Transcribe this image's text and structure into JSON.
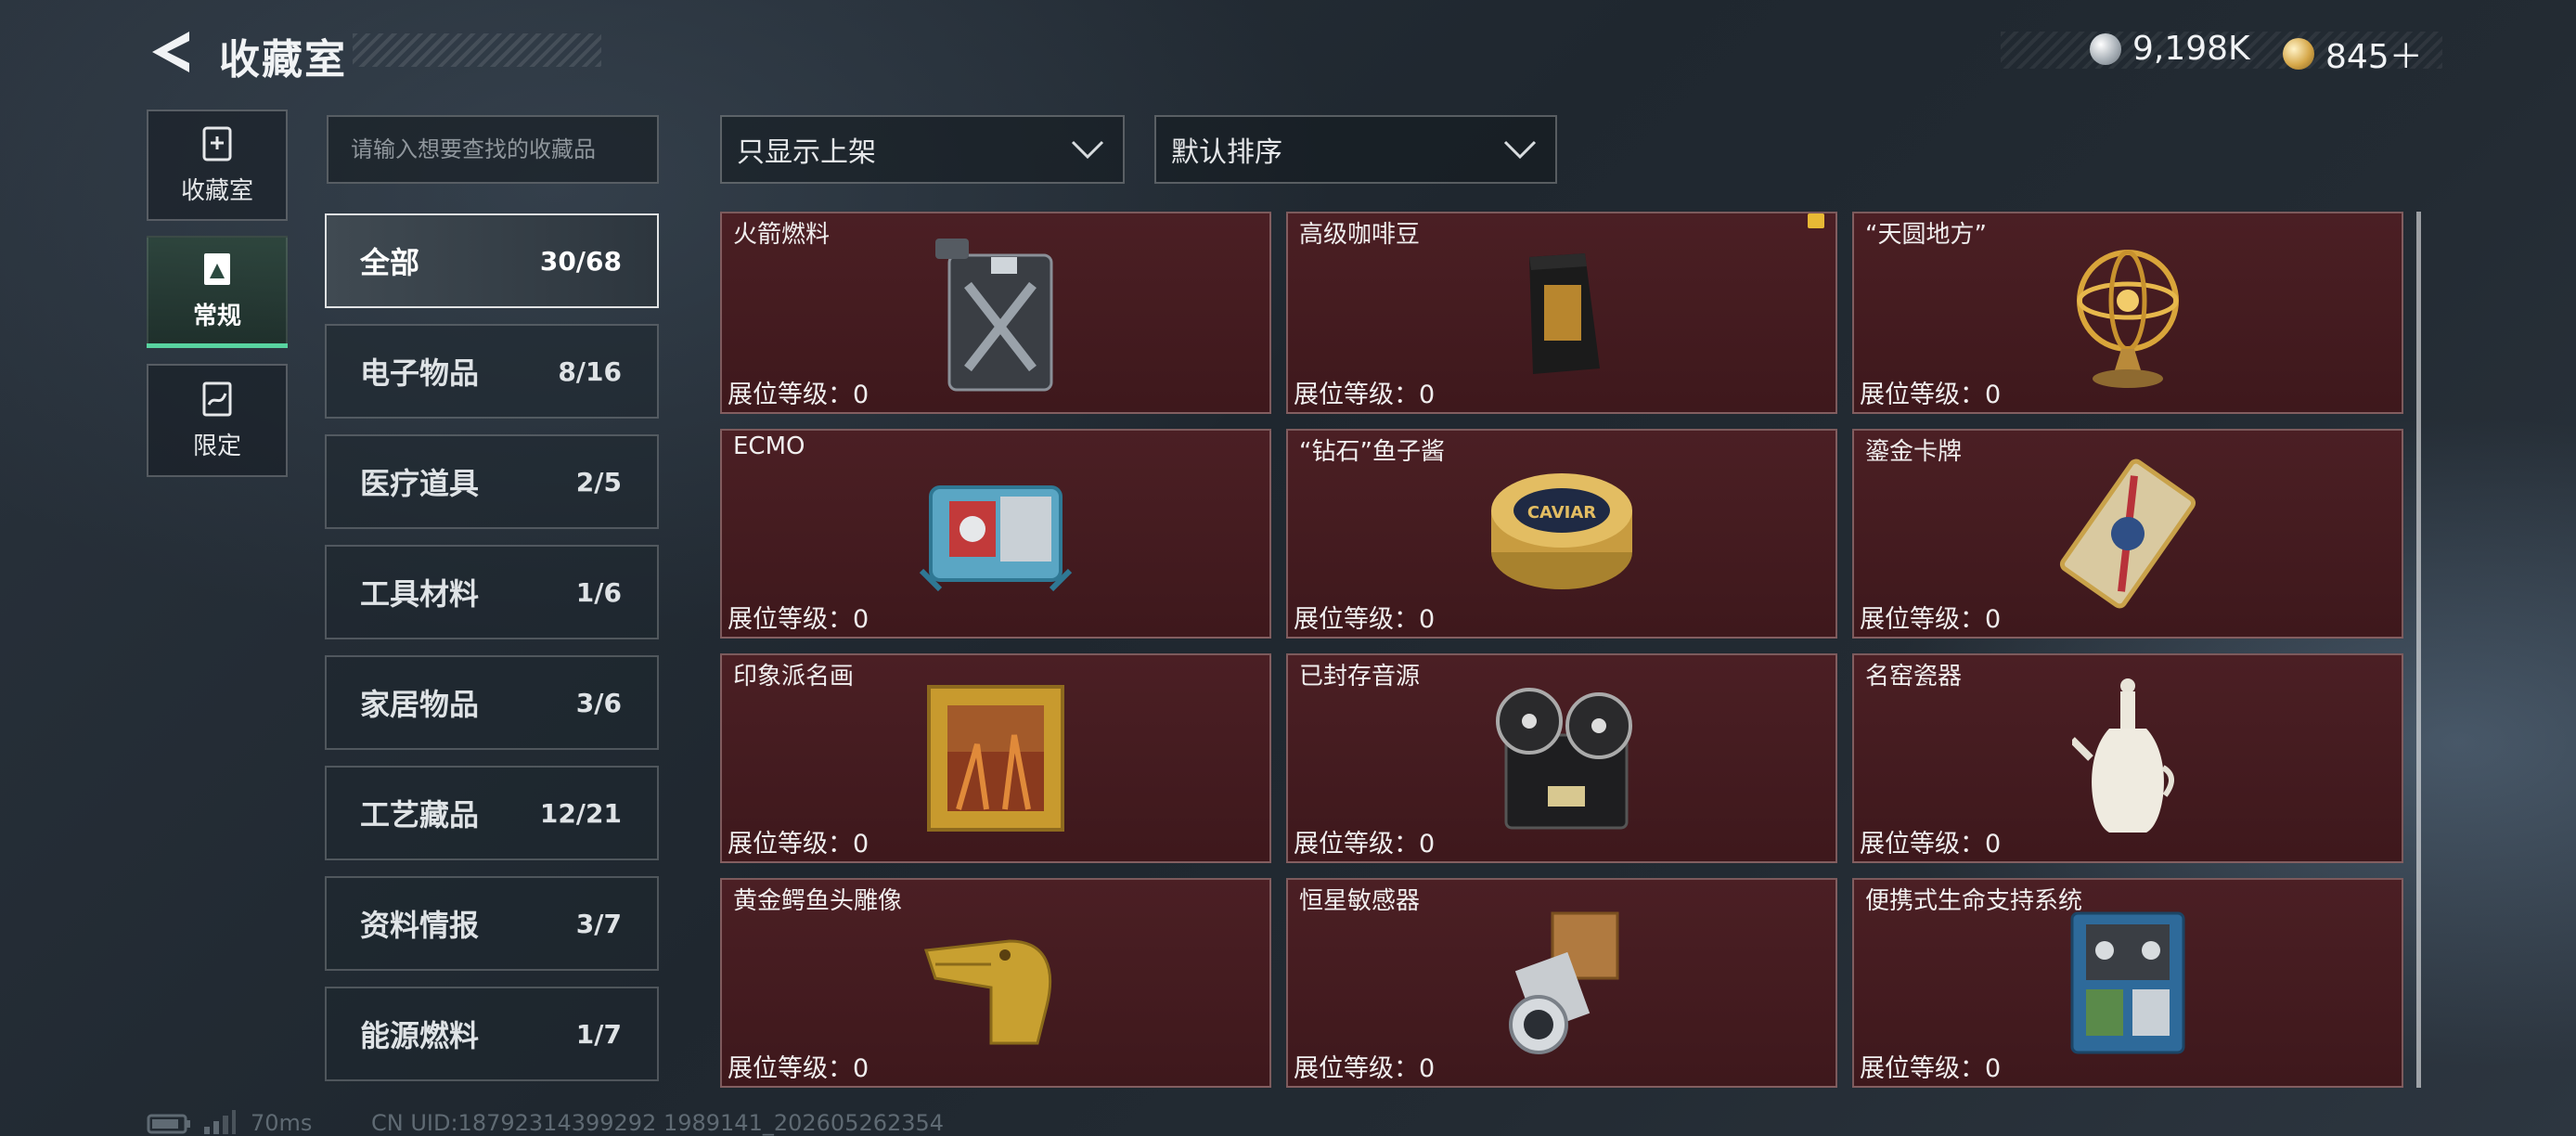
{
  "header": {
    "title": "收藏室",
    "currency_silver": "9,198K",
    "currency_gold": "845＋"
  },
  "nav": [
    {
      "label": "收藏室",
      "icon": "collection-icon",
      "active": false
    },
    {
      "label": "常规",
      "icon": "regular-icon",
      "active": true
    },
    {
      "label": "限定",
      "icon": "limited-icon",
      "active": false
    }
  ],
  "search": {
    "placeholder": "请输入想要查找的收藏品"
  },
  "filters": {
    "display_filter": "只显示上架",
    "sort": "默认排序"
  },
  "categories": [
    {
      "name": "全部",
      "count": "30/68",
      "active": true
    },
    {
      "name": "电子物品",
      "count": "8/16"
    },
    {
      "name": "医疗道具",
      "count": "2/5"
    },
    {
      "name": "工具材料",
      "count": "1/6"
    },
    {
      "name": "家居物品",
      "count": "3/6"
    },
    {
      "name": "工艺藏品",
      "count": "12/21"
    },
    {
      "name": "资料情报",
      "count": "3/7"
    },
    {
      "name": "能源燃料",
      "count": "1/7"
    }
  ],
  "items": [
    {
      "name": "火箭燃料",
      "level": "展位等级：0",
      "icon": "jerrycan-icon"
    },
    {
      "name": "高级咖啡豆",
      "level": "展位等级：0",
      "icon": "coffee-bag-icon",
      "badge": true
    },
    {
      "name": "“天圆地方”",
      "level": "展位等级：0",
      "icon": "armillary-sphere-icon"
    },
    {
      "name": "ECMO",
      "level": "展位等级：0",
      "icon": "ecmo-machine-icon"
    },
    {
      "name": "“钻石”鱼子酱",
      "level": "展位等级：0",
      "icon": "caviar-tin-icon",
      "tin_text": "CAVIAR"
    },
    {
      "name": "鎏金卡牌",
      "level": "展位等级：0",
      "icon": "gilded-card-icon"
    },
    {
      "name": "印象派名画",
      "level": "展位等级：0",
      "icon": "framed-painting-icon"
    },
    {
      "name": "已封存音源",
      "level": "展位等级：0",
      "icon": "reel-tape-recorder-icon"
    },
    {
      "name": "名窑瓷器",
      "level": "展位等级：0",
      "icon": "porcelain-vase-icon"
    },
    {
      "name": "黄金鳄鱼头雕像",
      "level": "展位等级：0",
      "icon": "gold-crocodile-head-icon"
    },
    {
      "name": "恒星敏感器",
      "level": "展位等级：0",
      "icon": "star-sensor-icon"
    },
    {
      "name": "便携式生命支持系统",
      "level": "展位等级：0",
      "icon": "life-support-system-icon"
    }
  ],
  "footer": {
    "latency": "70ms",
    "uid": "CN UID:18792314399292 1989141_202605262354"
  }
}
